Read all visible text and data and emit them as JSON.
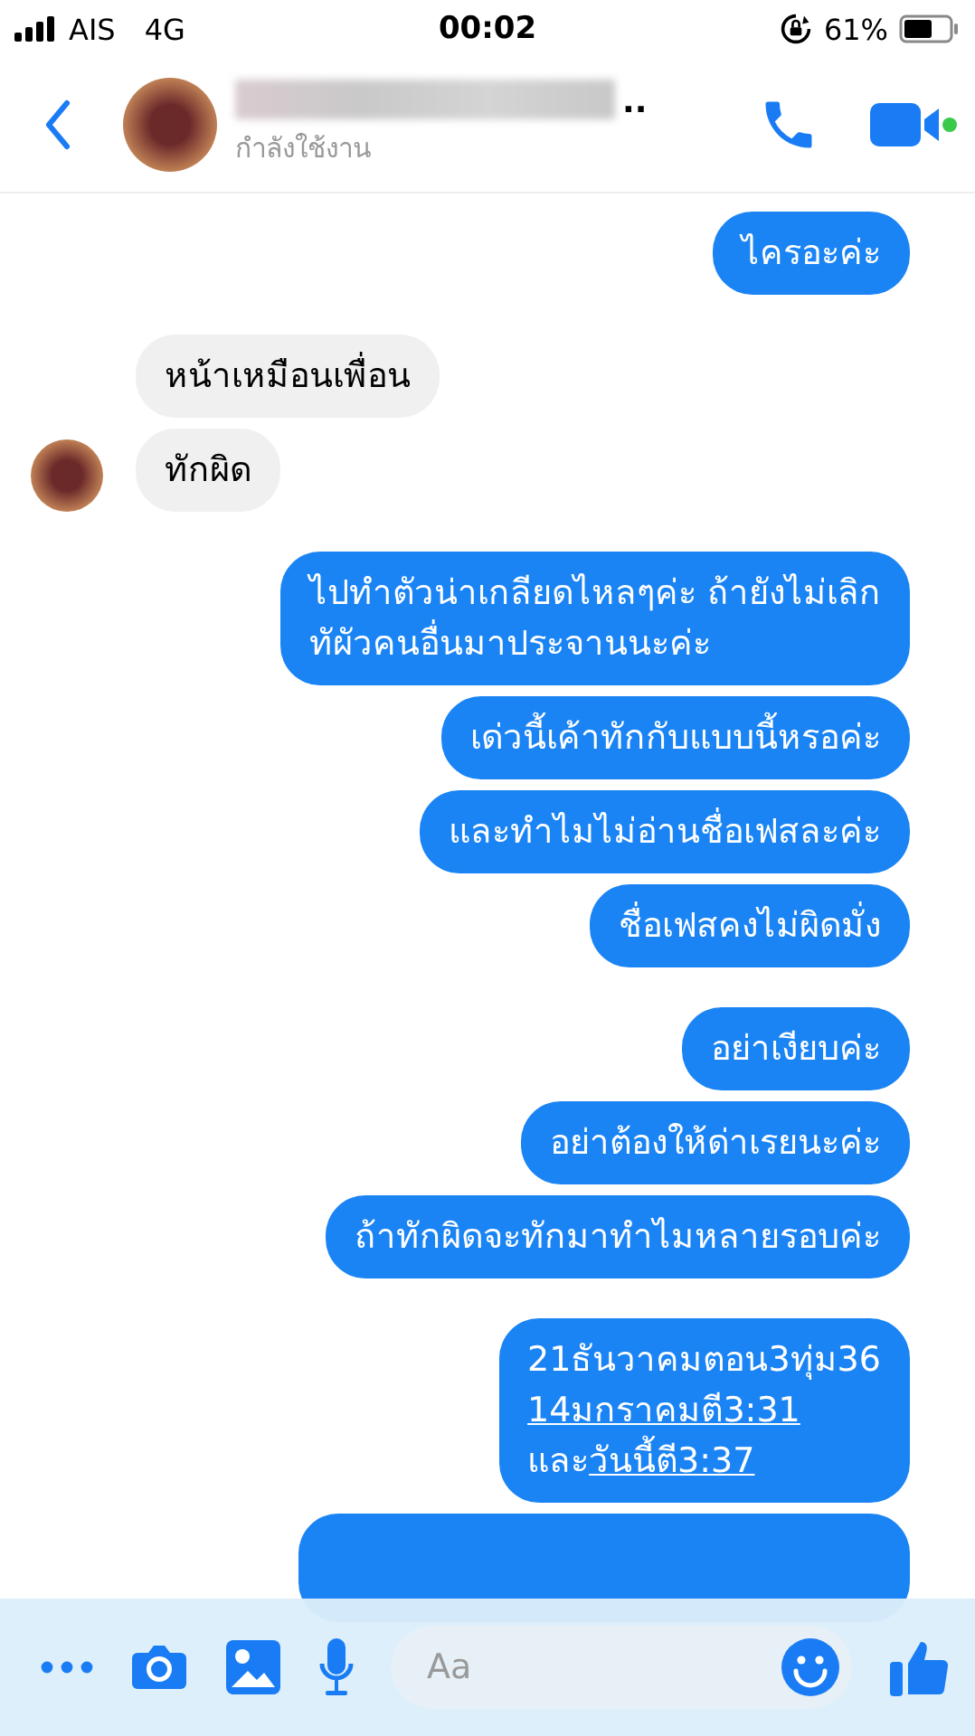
{
  "status_bar": {
    "carrier": "AIS",
    "network": "4G",
    "time": "00:02",
    "battery": "61%"
  },
  "header": {
    "name_tail": "..",
    "status": "กำลังใช้งาน"
  },
  "groups": [
    {
      "kind": "outgoing",
      "messages": [
        {
          "kind": "text",
          "lines": [
            [
              {
                "text": "ไครอะค่ะ"
              }
            ]
          ]
        }
      ]
    },
    {
      "kind": "incoming",
      "avatar": true,
      "messages": [
        {
          "kind": "text",
          "lines": [
            [
              {
                "text": "หน้าเหมือนเพื่อน"
              }
            ]
          ]
        },
        {
          "kind": "text",
          "lines": [
            [
              {
                "text": "ทักผิด"
              }
            ]
          ]
        }
      ]
    },
    {
      "kind": "outgoing",
      "messages": [
        {
          "kind": "text",
          "lines": [
            [
              {
                "text": "ไปทำตัวน่าเกลียดไหลๆค่ะ ถ้ายังไม่เลิก"
              }
            ],
            [
              {
                "text": "ทัผัวคนอื่นมาประจานนะค่ะ"
              }
            ]
          ]
        },
        {
          "kind": "text",
          "lines": [
            [
              {
                "text": "เด่วนี้เค้าทักกับแบบนี้หรอค่ะ"
              }
            ]
          ]
        },
        {
          "kind": "text",
          "lines": [
            [
              {
                "text": "และทำไมไม่อ่านชื่อเฟสละค่ะ"
              }
            ]
          ]
        },
        {
          "kind": "text",
          "lines": [
            [
              {
                "text": "ชื่อเฟสคงไม่ผิดมั่ง"
              }
            ]
          ]
        }
      ]
    },
    {
      "kind": "outgoing",
      "messages": [
        {
          "kind": "text",
          "lines": [
            [
              {
                "text": "อย่าเงียบค่ะ"
              }
            ]
          ]
        },
        {
          "kind": "text",
          "lines": [
            [
              {
                "text": "อย่าต้องให้ด่าเรยนะค่ะ"
              }
            ]
          ]
        },
        {
          "kind": "text",
          "lines": [
            [
              {
                "text": "ถ้าทักผิดจะทักมาทำไมหลายรอบค่ะ"
              }
            ]
          ]
        }
      ]
    },
    {
      "kind": "outgoing",
      "messages": [
        {
          "kind": "text",
          "lines": [
            [
              {
                "text": "21ธันวาคมตอน3ทุ่ม36"
              }
            ],
            [
              {
                "text": "14มกราคมตี3:31",
                "link": true
              }
            ],
            [
              {
                "text": "และ"
              },
              {
                "text": "วันนี้ตี3:37",
                "link": true
              }
            ]
          ]
        },
        {
          "kind": "covered"
        }
      ]
    }
  ],
  "composer": {
    "placeholder": "Aa"
  }
}
